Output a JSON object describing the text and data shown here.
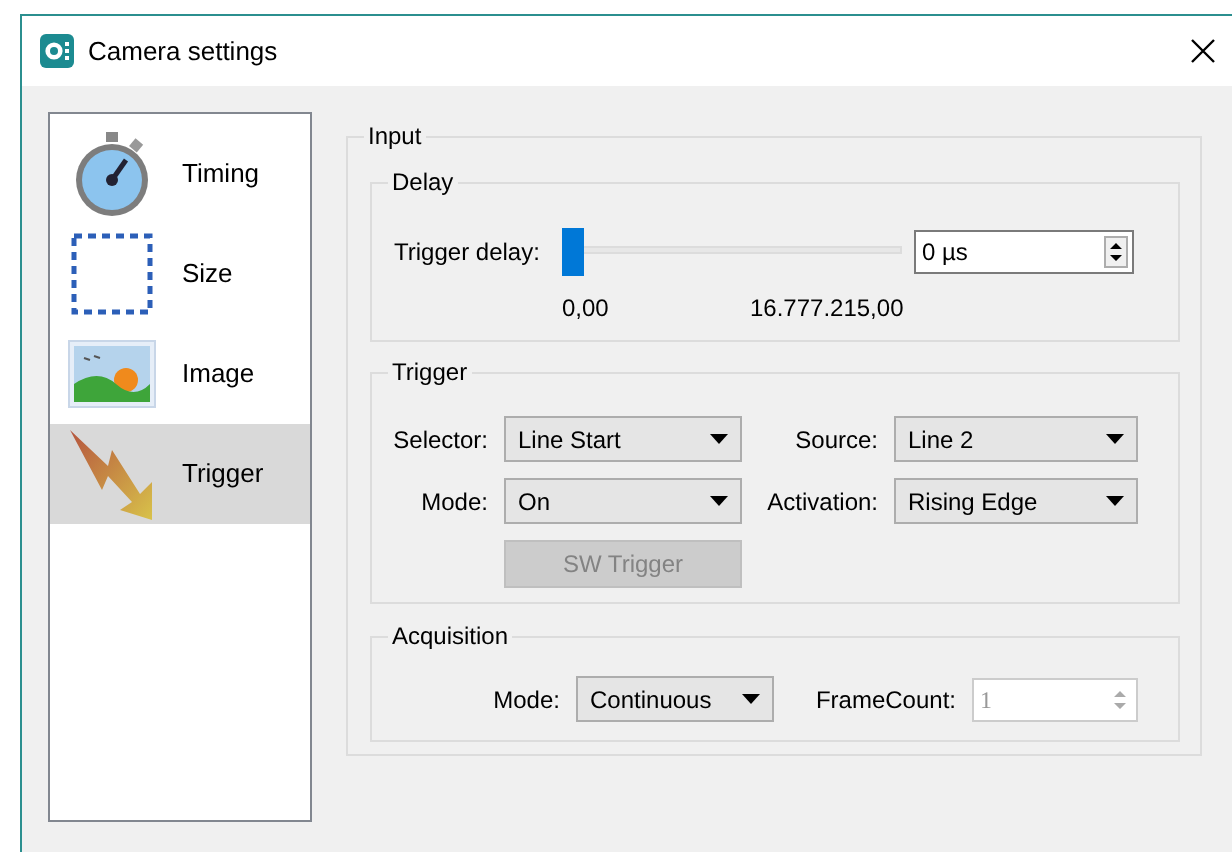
{
  "window": {
    "title": "Camera settings"
  },
  "sidebar": {
    "items": [
      {
        "label": "Timing",
        "kind": "stopwatch",
        "selected": false
      },
      {
        "label": "Size",
        "kind": "size",
        "selected": false
      },
      {
        "label": "Image",
        "kind": "image",
        "selected": false
      },
      {
        "label": "Trigger",
        "kind": "trigger",
        "selected": true
      }
    ]
  },
  "input": {
    "title": "Input",
    "delay": {
      "title": "Delay",
      "label": "Trigger delay:",
      "level": 0,
      "value": "0 µs",
      "min_label": "0,00",
      "max_label": "16.777.215,00"
    },
    "trigger": {
      "title": "Trigger",
      "fields": [
        {
          "label": "Selector:",
          "value": "Line Start"
        },
        {
          "label": "Source:",
          "value": "Line 2"
        },
        {
          "label": "Mode:",
          "value": "On"
        },
        {
          "label": "Activation:",
          "value": "Rising Edge"
        }
      ],
      "button": {
        "label": "SW Trigger",
        "disabled": true
      }
    },
    "acquisition": {
      "title": "Acquisition",
      "mode": {
        "label": "Mode:",
        "value": "Continuous"
      },
      "frame_count": {
        "label": "FrameCount:",
        "value": "1",
        "disabled": true
      }
    }
  }
}
